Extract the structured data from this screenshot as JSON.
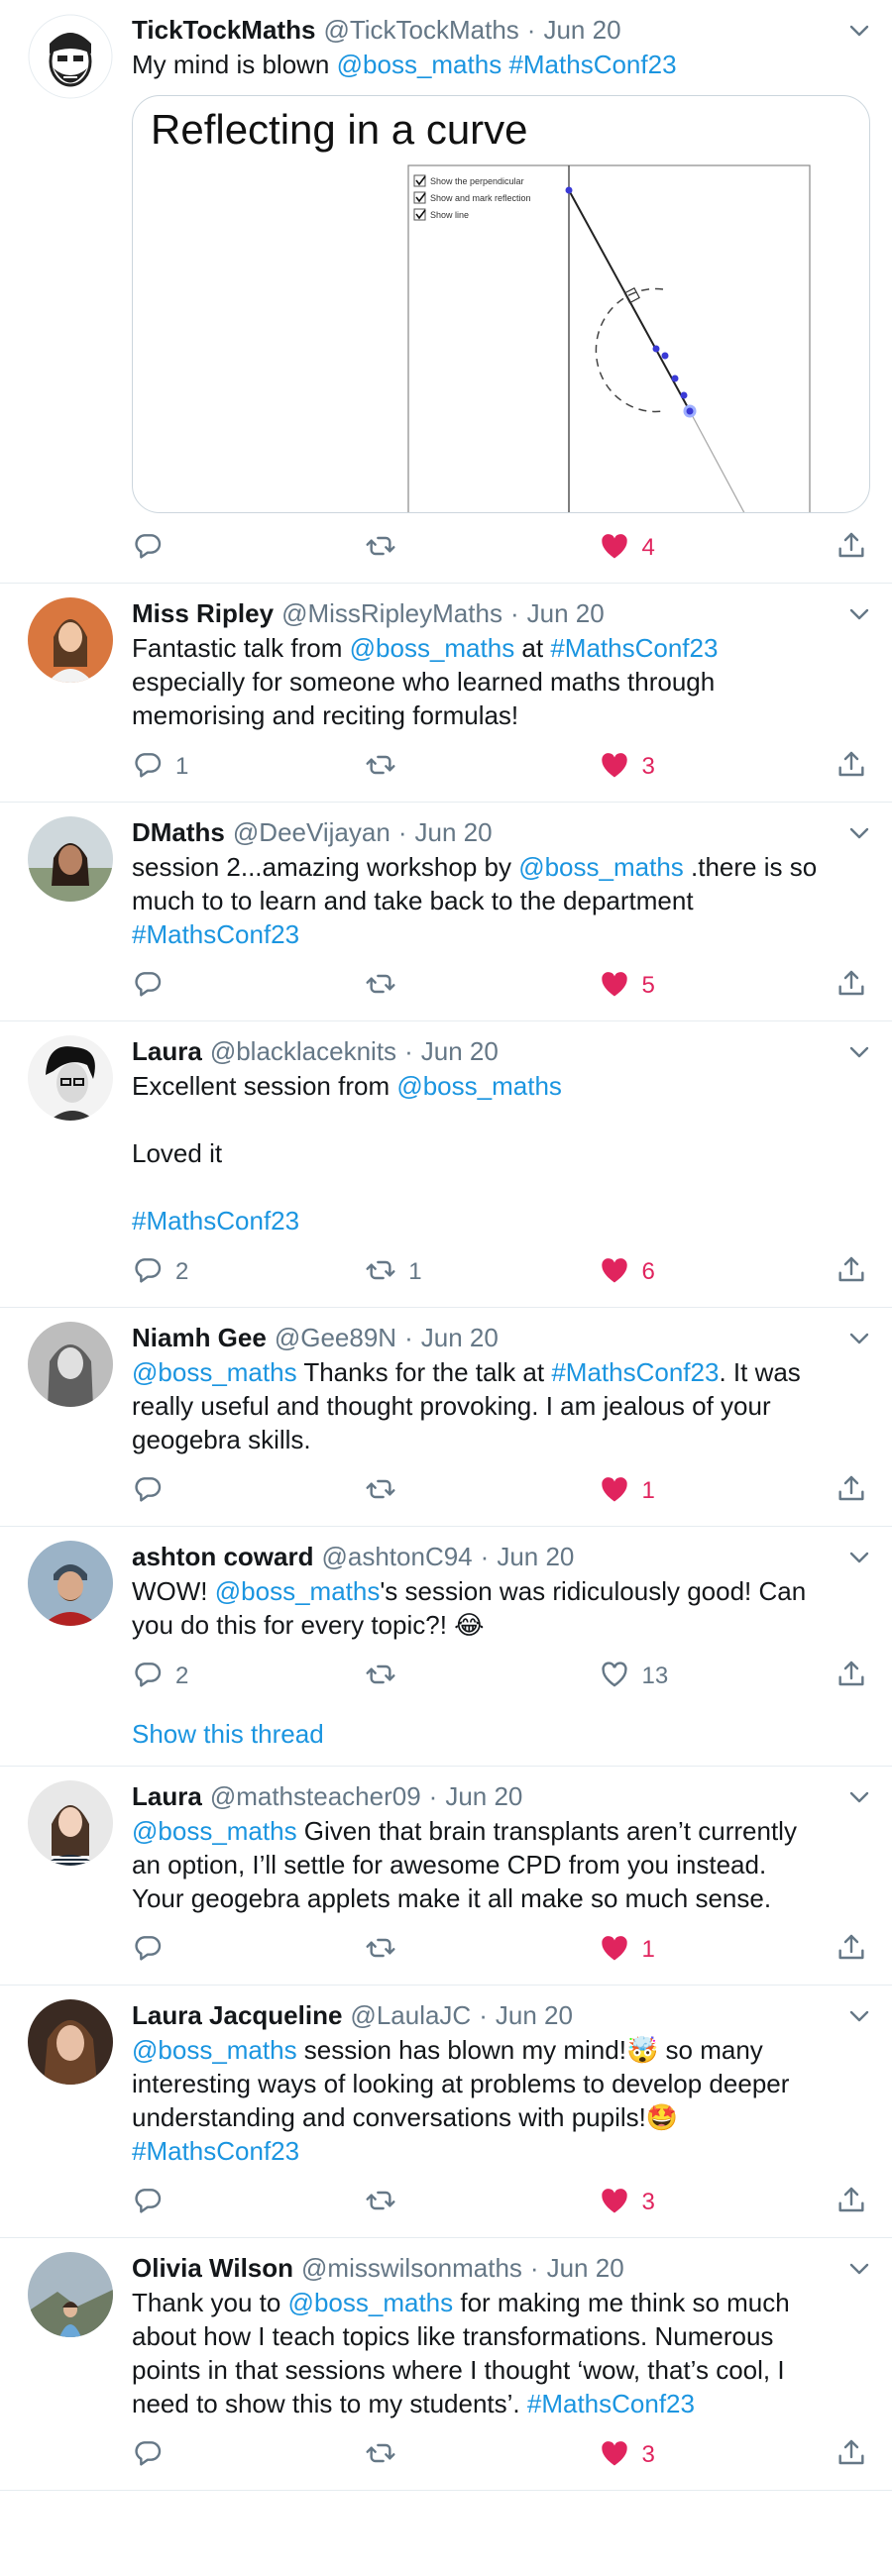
{
  "colors": {
    "link": "#1b95e0",
    "like": "#e0245e",
    "muted": "#657786",
    "text": "#14171a",
    "border": "#e6ecf0"
  },
  "tweets": [
    {
      "name": "TickTockMaths",
      "handle": "@TickTockMaths",
      "date": "Jun 20",
      "text": [
        {
          "t": "My mind is blown "
        },
        {
          "t": "@boss_maths",
          "link": true
        },
        {
          "t": " "
        },
        {
          "t": "#MathsConf23",
          "link": true
        }
      ],
      "media": {
        "title": "Reflecting in a curve",
        "checkboxes": [
          "Show the perpendicular",
          "Show and mark reflection",
          "Show line"
        ]
      },
      "replies": "",
      "retweets": "",
      "likes": "4",
      "liked": true
    },
    {
      "name": "Miss Ripley",
      "handle": "@MissRipleyMaths",
      "date": "Jun 20",
      "text": [
        {
          "t": "Fantastic talk from "
        },
        {
          "t": "@boss_maths",
          "link": true
        },
        {
          "t": " at "
        },
        {
          "t": "#MathsConf23",
          "link": true
        },
        {
          "t": "\nespecially for someone who learned maths through\nmemorising and reciting formulas!"
        }
      ],
      "replies": "1",
      "retweets": "",
      "likes": "3",
      "liked": true
    },
    {
      "name": "DMaths",
      "handle": "@DeeVijayan",
      "date": "Jun 20",
      "text": [
        {
          "t": "session 2...amazing workshop by "
        },
        {
          "t": "@boss_maths",
          "link": true
        },
        {
          "t": " .there is so\nmuch to to learn and take back to the department\n"
        },
        {
          "t": "#MathsConf23",
          "link": true
        }
      ],
      "replies": "",
      "retweets": "",
      "likes": "5",
      "liked": true
    },
    {
      "name": "Laura",
      "handle": "@blacklaceknits",
      "date": "Jun 20",
      "text": [
        {
          "t": "Excellent session from "
        },
        {
          "t": "@boss_maths",
          "link": true
        },
        {
          "t": "\n\nLoved it\n\n"
        },
        {
          "t": "#MathsConf23",
          "link": true
        }
      ],
      "replies": "2",
      "retweets": "1",
      "likes": "6",
      "liked": true
    },
    {
      "name": "Niamh Gee",
      "handle": "@Gee89N",
      "date": "Jun 20",
      "text": [
        {
          "t": "@boss_maths",
          "link": true
        },
        {
          "t": " Thanks for the talk at "
        },
        {
          "t": "#MathsConf23",
          "link": true
        },
        {
          "t": ". It was\nreally useful and thought provoking. I am jealous of your\ngeogebra skills."
        }
      ],
      "replies": "",
      "retweets": "",
      "likes": "1",
      "liked": true
    },
    {
      "name": "ashton coward",
      "handle": "@ashtonC94",
      "date": "Jun 20",
      "text": [
        {
          "t": "WOW! "
        },
        {
          "t": "@boss_maths",
          "link": true
        },
        {
          "t": "'s session was ridiculously good! Can\nyou do this for every topic?! 😂"
        }
      ],
      "replies": "2",
      "retweets": "",
      "likes": "13",
      "liked": false,
      "thread": "Show this thread"
    },
    {
      "name": "Laura",
      "handle": "@mathsteacher09",
      "date": "Jun 20",
      "text": [
        {
          "t": "@boss_maths",
          "link": true
        },
        {
          "t": " Given that brain transplants aren’t currently\nan option, I’ll settle for awesome CPD from you instead.\nYour geogebra applets make it all make so much sense."
        }
      ],
      "replies": "",
      "retweets": "",
      "likes": "1",
      "liked": true
    },
    {
      "name": "Laura Jacqueline",
      "handle": "@LaulaJC",
      "date": "Jun 20",
      "text": [
        {
          "t": "@boss_maths",
          "link": true
        },
        {
          "t": " session has blown my mind!🤯 so many\ninteresting ways of looking at problems to develop deeper\nunderstanding and conversations with pupils!🤩\n"
        },
        {
          "t": "#MathsConf23",
          "link": true
        }
      ],
      "replies": "",
      "retweets": "",
      "likes": "3",
      "liked": true
    },
    {
      "name": "Olivia Wilson",
      "handle": "@misswilsonmaths",
      "date": "Jun 20",
      "text": [
        {
          "t": "Thank you to "
        },
        {
          "t": "@boss_maths",
          "link": true
        },
        {
          "t": " for making me think so much\nabout how I teach topics like transformations. Numerous\npoints in that sessions where I thought ‘wow, that’s cool, I\nneed to show this to my students’. "
        },
        {
          "t": "#MathsConf23",
          "link": true
        }
      ],
      "replies": "",
      "retweets": "",
      "likes": "3",
      "liked": true
    }
  ]
}
